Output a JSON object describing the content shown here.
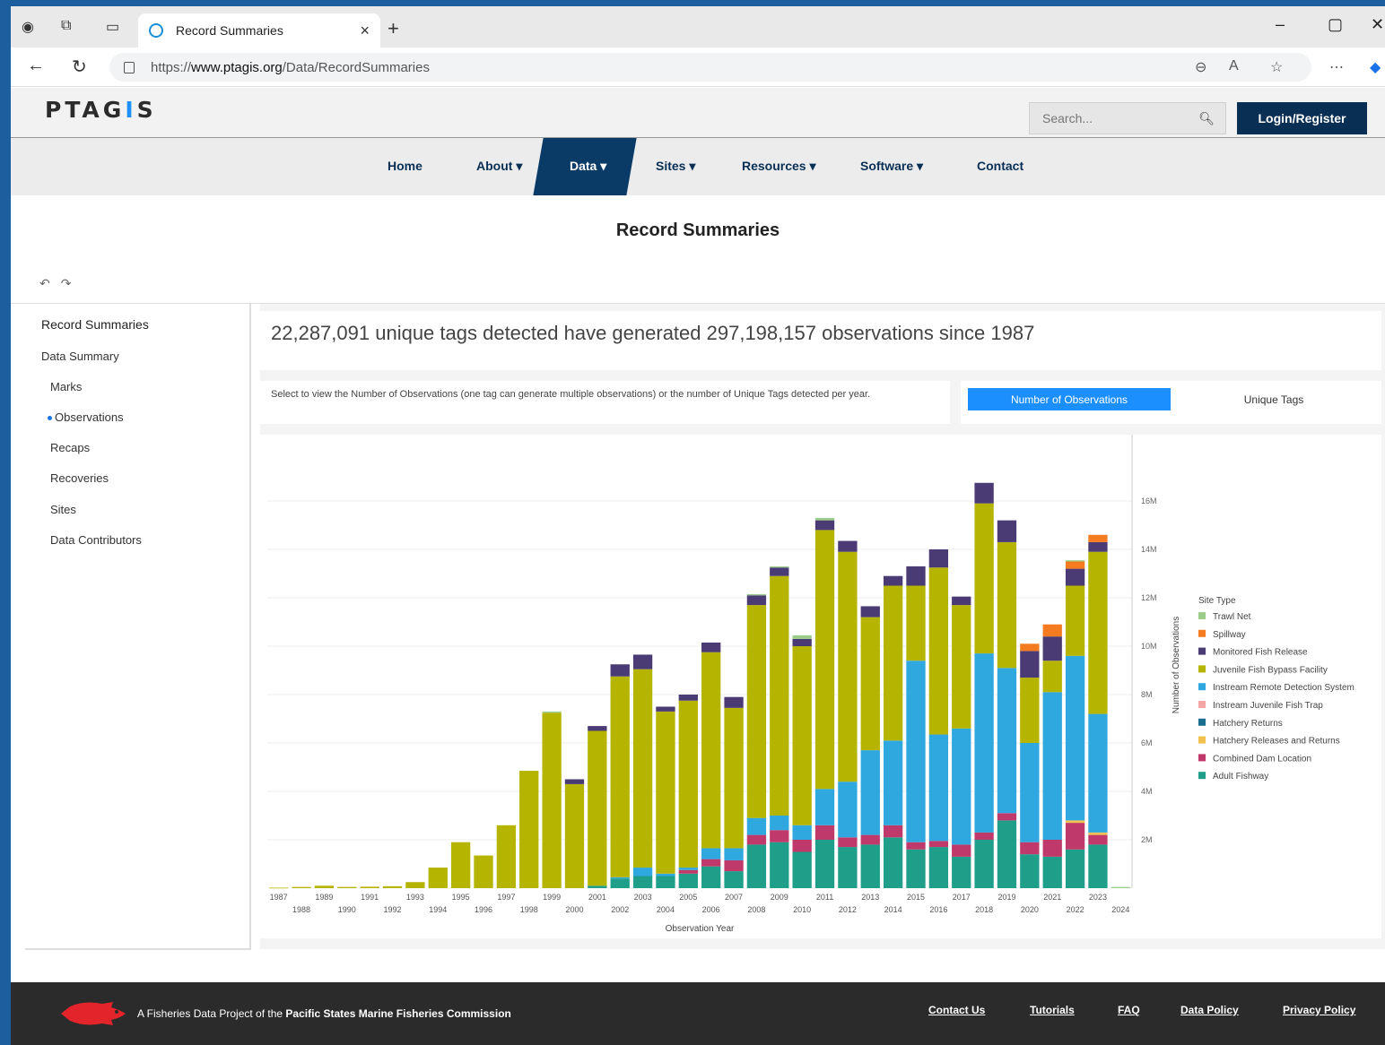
{
  "browser": {
    "tab_title": "Record Summaries",
    "url_prefix": "https://",
    "url_host": "www.ptagis.org",
    "url_path": "/Data/RecordSummaries"
  },
  "header": {
    "logo_a": "PTAG",
    "logo_b": "I",
    "logo_c": "S",
    "search_placeholder": "Search...",
    "login_label": "Login/Register"
  },
  "nav": {
    "home": "Home",
    "about": "About",
    "data": "Data",
    "sites": "Sites",
    "resources": "Resources",
    "software": "Software",
    "contact": "Contact"
  },
  "page_title": "Record Summaries",
  "sidebar": {
    "title": "Record Summaries",
    "section": "Data Summary",
    "items": [
      "Marks",
      "Observations",
      "Recaps",
      "Recoveries",
      "Sites",
      "Data Contributors"
    ],
    "active_item": "Observations"
  },
  "summary_text": "22,287,091 unique tags detected have generated 297,198,157 observations since 1987",
  "instructions": "Select to view the Number of Observations (one tag can generate multiple observations) or the number of Unique Tags detected per year.",
  "toggle": {
    "option_a": "Number of Observations",
    "option_b": "Unique Tags",
    "selected": "Number of Observations"
  },
  "chart_data": {
    "type": "bar",
    "stacked": true,
    "xlabel": "Observation Year",
    "ylabel": "Number of Observations",
    "y_ticks": [
      "2M",
      "4M",
      "6M",
      "8M",
      "10M",
      "12M",
      "14M",
      "16M"
    ],
    "ylim": [
      0,
      18000000
    ],
    "legend_title": "Site Type",
    "legend_position": "right",
    "categories": [
      "1987",
      "1988",
      "1989",
      "1990",
      "1991",
      "1992",
      "1993",
      "1994",
      "1995",
      "1996",
      "1997",
      "1998",
      "1999",
      "2000",
      "2001",
      "2002",
      "2003",
      "2004",
      "2005",
      "2006",
      "2007",
      "2008",
      "2009",
      "2010",
      "2011",
      "2012",
      "2013",
      "2014",
      "2015",
      "2016",
      "2017",
      "2018",
      "2019",
      "2020",
      "2021",
      "2022",
      "2023",
      "2024"
    ],
    "series": [
      {
        "name": "Adult Fishway",
        "color": "#1f9e89",
        "values": [
          0,
          0,
          0,
          0,
          0,
          0,
          0,
          0,
          0,
          0,
          0,
          0,
          0,
          0,
          100000,
          400000,
          500000,
          500000,
          600000,
          900000,
          700000,
          1800000,
          1900000,
          1500000,
          2000000,
          1700000,
          1800000,
          2100000,
          1600000,
          1700000,
          1300000,
          2000000,
          2800000,
          1400000,
          1300000,
          1600000,
          1800000,
          0
        ]
      },
      {
        "name": "Combined Dam Location",
        "color": "#c0396b",
        "values": [
          0,
          0,
          0,
          0,
          0,
          0,
          0,
          0,
          0,
          0,
          0,
          0,
          0,
          0,
          0,
          0,
          0,
          0,
          150000,
          300000,
          450000,
          400000,
          500000,
          500000,
          600000,
          400000,
          400000,
          500000,
          300000,
          250000,
          500000,
          300000,
          300000,
          500000,
          700000,
          1100000,
          400000,
          0
        ]
      },
      {
        "name": "Hatchery Releases and Returns",
        "color": "#f2c14e",
        "values": [
          0,
          0,
          0,
          0,
          0,
          0,
          0,
          0,
          0,
          0,
          0,
          0,
          0,
          0,
          0,
          0,
          0,
          0,
          0,
          0,
          0,
          0,
          0,
          0,
          0,
          0,
          0,
          0,
          0,
          0,
          0,
          0,
          0,
          0,
          0,
          100000,
          100000,
          0
        ]
      },
      {
        "name": "Hatchery Returns",
        "color": "#1a6d8e",
        "values": [
          0,
          0,
          0,
          0,
          0,
          0,
          0,
          0,
          0,
          0,
          0,
          0,
          0,
          0,
          0,
          0,
          0,
          0,
          0,
          0,
          0,
          0,
          0,
          0,
          0,
          0,
          0,
          0,
          0,
          0,
          0,
          0,
          0,
          0,
          0,
          0,
          0,
          0
        ]
      },
      {
        "name": "Instream Juvenile Fish Trap",
        "color": "#f4a6a6",
        "values": [
          0,
          0,
          0,
          0,
          0,
          0,
          0,
          0,
          0,
          0,
          0,
          0,
          0,
          0,
          0,
          0,
          0,
          0,
          0,
          0,
          0,
          0,
          0,
          0,
          0,
          0,
          0,
          0,
          0,
          0,
          0,
          0,
          0,
          0,
          0,
          0,
          0,
          0
        ]
      },
      {
        "name": "Instream Remote Detection System",
        "color": "#2fa7df",
        "values": [
          0,
          0,
          0,
          0,
          0,
          0,
          0,
          0,
          0,
          0,
          0,
          0,
          0,
          0,
          0,
          50000,
          350000,
          100000,
          100000,
          450000,
          500000,
          700000,
          600000,
          600000,
          1500000,
          2300000,
          3500000,
          3500000,
          7500000,
          4400000,
          4800000,
          7400000,
          6000000,
          4100000,
          6100000,
          6800000,
          4900000,
          0
        ]
      },
      {
        "name": "Juvenile Fish Bypass Facility",
        "color": "#b5b400",
        "values": [
          20000,
          50000,
          100000,
          50000,
          60000,
          80000,
          250000,
          850000,
          1900000,
          1350000,
          2600000,
          4850000,
          7250000,
          4300000,
          6400000,
          8300000,
          8200000,
          6700000,
          6900000,
          8100000,
          5800000,
          8800000,
          9900000,
          7400000,
          10700000,
          9500000,
          5500000,
          6400000,
          3100000,
          6900000,
          5100000,
          6200000,
          5200000,
          2700000,
          1300000,
          2900000,
          6700000,
          0
        ]
      },
      {
        "name": "Monitored Fish Release",
        "color": "#4a3b75",
        "values": [
          0,
          0,
          0,
          0,
          0,
          0,
          0,
          0,
          0,
          0,
          0,
          0,
          0,
          200000,
          200000,
          500000,
          600000,
          200000,
          250000,
          400000,
          450000,
          400000,
          350000,
          300000,
          400000,
          450000,
          450000,
          400000,
          800000,
          750000,
          350000,
          850000,
          900000,
          1100000,
          1000000,
          700000,
          400000,
          0
        ]
      },
      {
        "name": "Spillway",
        "color": "#f47b20",
        "values": [
          0,
          0,
          0,
          0,
          0,
          0,
          0,
          0,
          0,
          0,
          0,
          0,
          0,
          0,
          0,
          0,
          0,
          0,
          0,
          0,
          0,
          0,
          0,
          0,
          0,
          0,
          0,
          0,
          0,
          0,
          0,
          0,
          0,
          300000,
          500000,
          300000,
          300000,
          0
        ]
      },
      {
        "name": "Trawl Net",
        "color": "#9ccc8a",
        "values": [
          0,
          0,
          0,
          0,
          0,
          0,
          0,
          0,
          0,
          0,
          0,
          0,
          50000,
          0,
          0,
          0,
          0,
          0,
          0,
          0,
          0,
          50000,
          50000,
          150000,
          100000,
          0,
          0,
          0,
          0,
          0,
          0,
          0,
          0,
          0,
          0,
          50000,
          0,
          50000
        ]
      }
    ]
  },
  "footer": {
    "text_prefix": "A Fisheries Data Project of the",
    "text_org": "Pacific States Marine Fisheries Commission",
    "links": [
      "Contact Us",
      "Tutorials",
      "FAQ",
      "Data Policy",
      "Privacy Policy"
    ]
  }
}
